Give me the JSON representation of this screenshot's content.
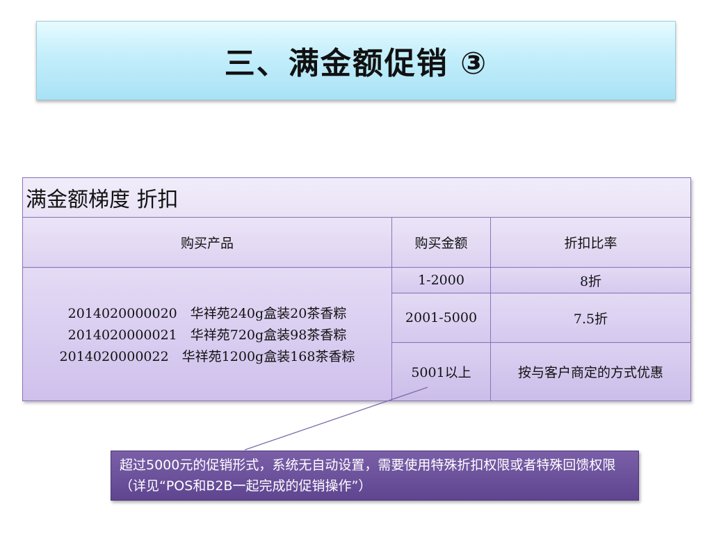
{
  "title": "三、满金额促销 ③",
  "table": {
    "caption": "满金额梯度 折扣",
    "headers": [
      "购买产品",
      "购买金额",
      "折扣比率"
    ],
    "products": [
      "2014020000020　华祥苑240g盒装20茶香粽",
      "2014020000021　华祥苑720g盒装98茶香粽",
      "2014020000022　华祥苑1200g盒装168茶香粽"
    ],
    "tiers": [
      {
        "amount": "1-2000",
        "rate": "8折"
      },
      {
        "amount": "2001-5000",
        "rate": "7.5折"
      },
      {
        "amount": "5001以上",
        "rate": "按与客户商定的方式优惠"
      }
    ]
  },
  "note": "超过5000元的促销形式，系统无自动设置，需要使用特殊折扣权限或者特殊回馈权限（详见“POS和B2B一起完成的促销操作”）"
}
